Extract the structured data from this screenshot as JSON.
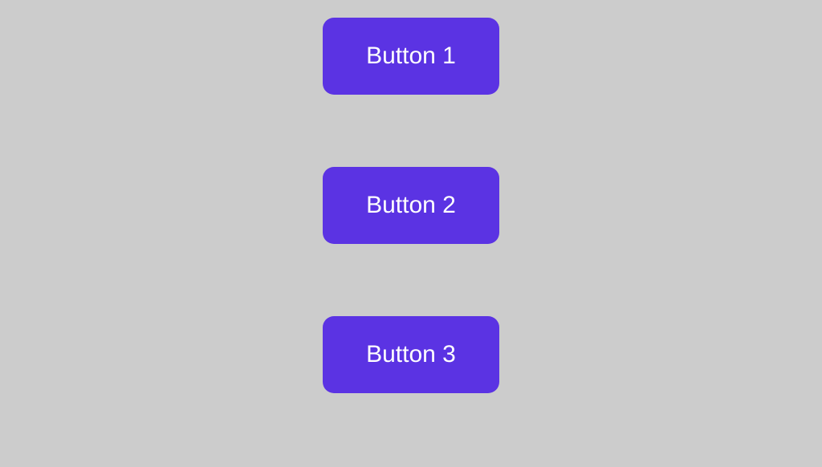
{
  "buttons": [
    {
      "label": "Button 1"
    },
    {
      "label": "Button 2"
    },
    {
      "label": "Button 3"
    }
  ],
  "colors": {
    "background": "#cccccc",
    "button_background": "#5b33e3",
    "button_text": "#ffffff"
  }
}
